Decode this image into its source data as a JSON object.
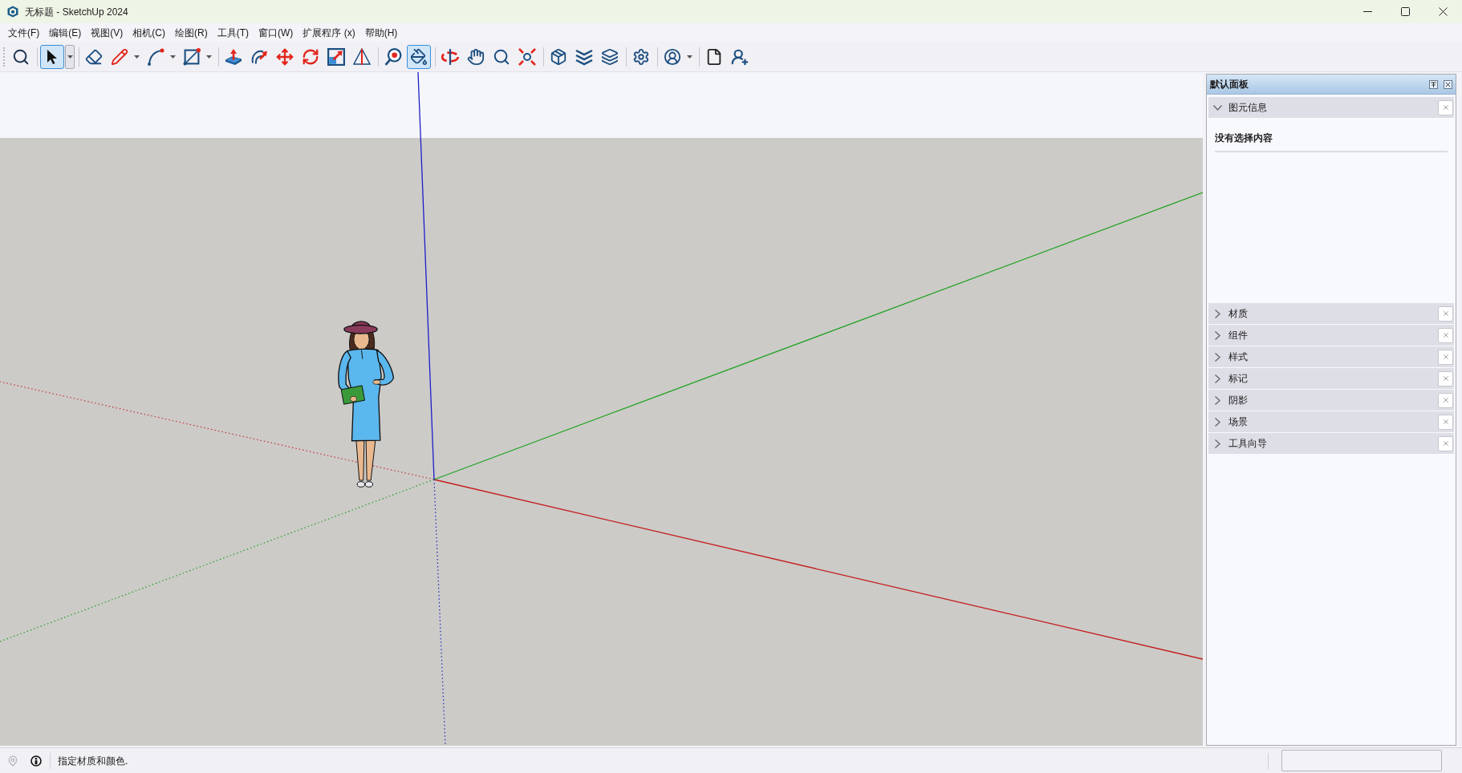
{
  "window": {
    "title": "无标题 - SketchUp 2024"
  },
  "menu": [
    "文件(F)",
    "编辑(E)",
    "视图(V)",
    "相机(C)",
    "绘图(R)",
    "工具(T)",
    "窗口(W)",
    "扩展程序 (x)",
    "帮助(H)"
  ],
  "toolbar": {
    "groups": [
      [
        {
          "selected": false,
          "dropdown": false
        }
      ],
      [
        {
          "selected": true,
          "dropdown": true
        }
      ],
      [
        {
          "selected": false,
          "dropdown": false
        },
        {
          "selected": false,
          "dropdown": true
        },
        {
          "selected": false,
          "dropdown": true
        },
        {
          "selected": false,
          "dropdown": true
        }
      ],
      [
        {
          "selected": false,
          "dropdown": false
        },
        {
          "selected": false,
          "dropdown": false
        },
        {
          "selected": false,
          "dropdown": false
        },
        {
          "selected": false,
          "dropdown": false
        },
        {
          "selected": false,
          "dropdown": false
        },
        {
          "selected": false,
          "dropdown": false
        }
      ],
      [
        {
          "selected": false,
          "dropdown": false
        },
        {
          "selected": true,
          "dropdown": false
        }
      ],
      [
        {
          "selected": false,
          "dropdown": false
        },
        {
          "selected": false,
          "dropdown": false
        },
        {
          "selected": false,
          "dropdown": false
        },
        {
          "selected": false,
          "dropdown": false
        }
      ],
      [
        {
          "selected": false,
          "dropdown": false
        },
        {
          "selected": false,
          "dropdown": false
        },
        {
          "selected": false,
          "dropdown": false
        }
      ],
      [
        {
          "selected": false,
          "dropdown": false
        }
      ],
      [
        {
          "selected": false,
          "dropdown": true
        }
      ],
      [
        {
          "selected": false,
          "dropdown": false
        },
        {
          "selected": false,
          "dropdown": false
        }
      ]
    ]
  },
  "panel": {
    "title": "默认面板",
    "sections": [
      {
        "title": "图元信息",
        "expanded": true,
        "content": "没有选择内容"
      },
      {
        "title": "材质",
        "expanded": false
      },
      {
        "title": "组件",
        "expanded": false
      },
      {
        "title": "样式",
        "expanded": false
      },
      {
        "title": "标记",
        "expanded": false
      },
      {
        "title": "阴影",
        "expanded": false
      },
      {
        "title": "场景",
        "expanded": false
      },
      {
        "title": "工具向导",
        "expanded": false
      }
    ]
  },
  "status_bar": {
    "icons": [
      {
        "disabled": true
      },
      {
        "disabled": false
      }
    ],
    "message": "指定材质和颜色."
  }
}
